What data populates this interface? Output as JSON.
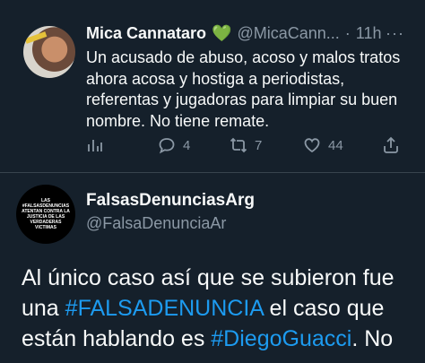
{
  "tweet1": {
    "author_name": "Mica Cannataro",
    "badge": "💚",
    "handle": "@MicaCann...",
    "separator": "·",
    "time": "11h",
    "more": "···",
    "text": "Un acusado de abuso, acoso y malos tratos ahora acosa y hostiga a periodistas, referentas y jugadoras para limpiar su buen nombre. No tiene remate.",
    "replies": "4",
    "retweets": "7",
    "likes": "44"
  },
  "tweet2": {
    "author_name": "FalsasDenunciasArg",
    "handle": "@FalsaDenunciaAr",
    "avatar_text": "LAS #FALSASDENUNCIAS ATENTAN CONTRA LA JUSTICIA DE LAS VERDADERAS VICTIMAS",
    "text_line1": "Al único caso así que se subieron fue",
    "text_line2_pre": "una ",
    "hashtag1": "#FALSADENUNCIA",
    "text_line2_post": " el  caso que",
    "text_line3_pre": "están hablando es ",
    "hashtag2": "#DiegoGuacci",
    "text_line3_post": ". No"
  },
  "icons": [
    "reply-icon",
    "retweet-icon",
    "like-icon",
    "analytics-icon",
    "share-icon",
    "more-icon"
  ]
}
